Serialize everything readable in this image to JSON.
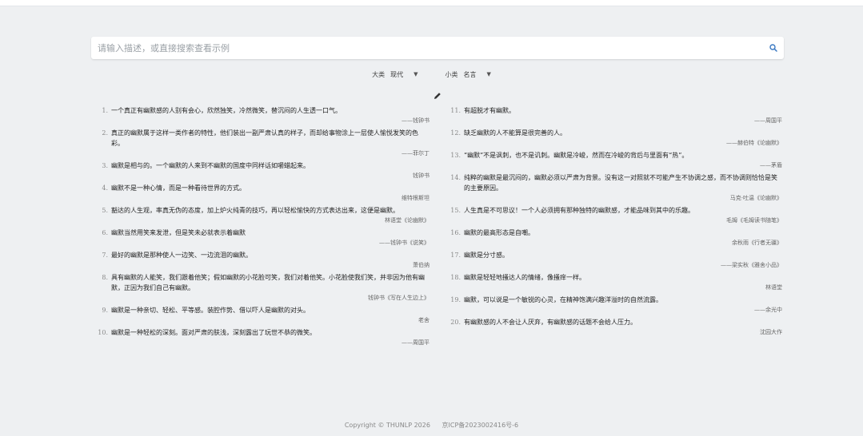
{
  "search": {
    "placeholder": "请输入描述，或直接搜索查看示例"
  },
  "filters": [
    {
      "label": "大类",
      "value": "现代"
    },
    {
      "label": "小类",
      "value": "名言"
    }
  ],
  "quotes_left": [
    {
      "num": "1.",
      "text": "一个真正有幽默感的人别有会心，欣然独笑，冷然微笑，替沉闷的人生透一口气。",
      "source": "——钱钟书"
    },
    {
      "num": "2.",
      "text": "真正的幽默属于这样一类作者的特性，他们装出一副严肃认真的样子，而却给事物涂上一层使人愉悦发笑的色彩。",
      "source": "——菲尔丁"
    },
    {
      "num": "3.",
      "text": "幽默是相与的。一个幽默的人来到不幽默的国度中同样话如嚼蜡起来。",
      "source": "钱钟书"
    },
    {
      "num": "4.",
      "text": "幽默不是一种心情，而是一种看待世界的方式。",
      "source": "维特根斯坦"
    },
    {
      "num": "5.",
      "text": "豁达的人生观，率真无伪的态度，加上炉火纯青的技巧，再以轻松愉快的方式表达出来，这便是幽默。",
      "source": "林语堂《论幽默》"
    },
    {
      "num": "6.",
      "text": "幽默当然用笑来发泄，但是笑未必就表示着幽默",
      "source": "——钱钟书《说笑》"
    },
    {
      "num": "7.",
      "text": "最好的幽默是那种使人一边笑、一边流泪的幽默。",
      "source": "萧伯纳"
    },
    {
      "num": "8.",
      "text": "具有幽默的人能笑，我们跟着他笑；假如幽默的小花脸可笑，我们对着他笑。小花脸使我们笑，并非因为他有幽默，正因为我们自己有幽默。",
      "source": "钱钟书《写在人生边上》"
    },
    {
      "num": "9.",
      "text": "幽默是一种亲切、轻松、平等感。装腔作势、借以吓人是幽默的对头。",
      "source": "老舍"
    },
    {
      "num": "10.",
      "text": "幽默是一种轻松的深刻。面对严肃的肤浅，深刻露出了玩世不恭的微笑。",
      "source": "——周国平"
    }
  ],
  "quotes_right": [
    {
      "num": "11.",
      "text": "有超脱才有幽默。",
      "source": "——周国平"
    },
    {
      "num": "12.",
      "text": "缺乏幽默的人不能算是很完善的人。",
      "source": "——赫伯特《论幽默》"
    },
    {
      "num": "13.",
      "text": "“幽默”不是讽刺，也不是讥刺。幽默是冷峻，然而在冷峻的背后与里面有“热”。",
      "source": "——茅盾"
    },
    {
      "num": "14.",
      "text": "纯粹的幽默是最沉闷的，幽默必须以严肃为背景。没有这一对照就不可能产生不协调之感，而不协调则恰恰是笑的主要原因。",
      "source": "马克·吐温《论幽默》"
    },
    {
      "num": "15.",
      "text": "人生真是不可思议！一个人必须拥有那种独特的幽默感，才能品味到其中的乐趣。",
      "source": "毛姆《毛姆读书随笔》"
    },
    {
      "num": "16.",
      "text": "幽默的最高形态是自嘲。",
      "source": "余秋雨《行者无疆》"
    },
    {
      "num": "17.",
      "text": "幽默是分寸感。",
      "source": "——梁实秋《雅舍小品》"
    },
    {
      "num": "18.",
      "text": "幽默是轻轻地搔达人的情绪，像搔痒一样。",
      "source": "林语堂"
    },
    {
      "num": "19.",
      "text": "幽默，可以说是一个敏锐的心灵，在精神饱满兴趣洋溢时的自然流露。",
      "source": "——余光中"
    },
    {
      "num": "20.",
      "text": "有幽默感的人不会让人厌弃，有幽默感的话题不会给人压力。",
      "source": "沈园大作"
    }
  ],
  "footer": {
    "copyright": "Copyright © THUNLP 2026",
    "icp": "京ICP备2023002416号-6"
  }
}
